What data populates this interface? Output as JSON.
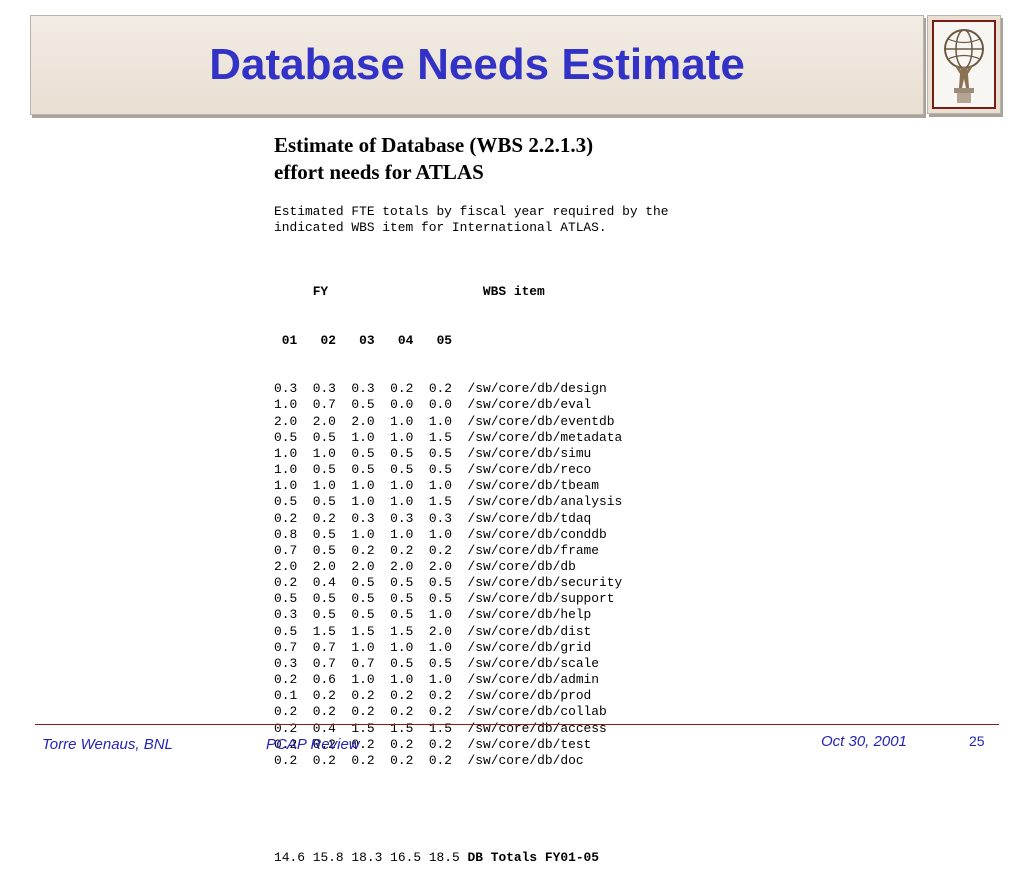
{
  "title": "Database Needs Estimate",
  "heading": [
    "Estimate of Database (WBS 2.2.1.3)",
    "effort needs for ATLAS"
  ],
  "description": [
    "Estimated FTE totals by fiscal year required by the",
    "indicated WBS item for International ATLAS."
  ],
  "table": {
    "group_header_fy": "FY",
    "group_header_item": "WBS item",
    "years": [
      "01",
      "02",
      "03",
      "04",
      "05"
    ],
    "rows": [
      {
        "values": [
          "0.3",
          "0.3",
          "0.3",
          "0.2",
          "0.2"
        ],
        "item": "/sw/core/db/design"
      },
      {
        "values": [
          "1.0",
          "0.7",
          "0.5",
          "0.0",
          "0.0"
        ],
        "item": "/sw/core/db/eval"
      },
      {
        "values": [
          "2.0",
          "2.0",
          "2.0",
          "1.0",
          "1.0"
        ],
        "item": "/sw/core/db/eventdb"
      },
      {
        "values": [
          "0.5",
          "0.5",
          "1.0",
          "1.0",
          "1.5"
        ],
        "item": "/sw/core/db/metadata"
      },
      {
        "values": [
          "1.0",
          "1.0",
          "0.5",
          "0.5",
          "0.5"
        ],
        "item": "/sw/core/db/simu"
      },
      {
        "values": [
          "1.0",
          "0.5",
          "0.5",
          "0.5",
          "0.5"
        ],
        "item": "/sw/core/db/reco"
      },
      {
        "values": [
          "1.0",
          "1.0",
          "1.0",
          "1.0",
          "1.0"
        ],
        "item": "/sw/core/db/tbeam"
      },
      {
        "values": [
          "0.5",
          "0.5",
          "1.0",
          "1.0",
          "1.5"
        ],
        "item": "/sw/core/db/analysis"
      },
      {
        "values": [
          "0.2",
          "0.2",
          "0.3",
          "0.3",
          "0.3"
        ],
        "item": "/sw/core/db/tdaq"
      },
      {
        "values": [
          "0.8",
          "0.5",
          "1.0",
          "1.0",
          "1.0"
        ],
        "item": "/sw/core/db/conddb"
      },
      {
        "values": [
          "0.7",
          "0.5",
          "0.2",
          "0.2",
          "0.2"
        ],
        "item": "/sw/core/db/frame"
      },
      {
        "values": [
          "2.0",
          "2.0",
          "2.0",
          "2.0",
          "2.0"
        ],
        "item": "/sw/core/db/db"
      },
      {
        "values": [
          "0.2",
          "0.4",
          "0.5",
          "0.5",
          "0.5"
        ],
        "item": "/sw/core/db/security"
      },
      {
        "values": [
          "0.5",
          "0.5",
          "0.5",
          "0.5",
          "0.5"
        ],
        "item": "/sw/core/db/support"
      },
      {
        "values": [
          "0.3",
          "0.5",
          "0.5",
          "0.5",
          "1.0"
        ],
        "item": "/sw/core/db/help"
      },
      {
        "values": [
          "0.5",
          "1.5",
          "1.5",
          "1.5",
          "2.0"
        ],
        "item": "/sw/core/db/dist"
      },
      {
        "values": [
          "0.7",
          "0.7",
          "1.0",
          "1.0",
          "1.0"
        ],
        "item": "/sw/core/db/grid"
      },
      {
        "values": [
          "0.3",
          "0.7",
          "0.7",
          "0.5",
          "0.5"
        ],
        "item": "/sw/core/db/scale"
      },
      {
        "values": [
          "0.2",
          "0.6",
          "1.0",
          "1.0",
          "1.0"
        ],
        "item": "/sw/core/db/admin"
      },
      {
        "values": [
          "0.1",
          "0.2",
          "0.2",
          "0.2",
          "0.2"
        ],
        "item": "/sw/core/db/prod"
      },
      {
        "values": [
          "0.2",
          "0.2",
          "0.2",
          "0.2",
          "0.2"
        ],
        "item": "/sw/core/db/collab"
      },
      {
        "values": [
          "0.2",
          "0.4",
          "1.5",
          "1.5",
          "1.5"
        ],
        "item": "/sw/core/db/access"
      },
      {
        "values": [
          "0.2",
          "0.2",
          "0.2",
          "0.2",
          "0.2"
        ],
        "item": "/sw/core/db/test"
      },
      {
        "values": [
          "0.2",
          "0.2",
          "0.2",
          "0.2",
          "0.2"
        ],
        "item": "/sw/core/db/doc"
      }
    ],
    "totals": {
      "values": [
        "14.6",
        "15.8",
        "18.3",
        "16.5",
        "18.5"
      ],
      "label": "DB Totals FY01-05"
    }
  },
  "footer": {
    "author": "Torre Wenaus, BNL",
    "event": "PCAP Review",
    "date": "Oct 30, 2001",
    "page": "25"
  },
  "logo": {
    "icon": "atlas-statue-icon"
  },
  "colors": {
    "title": "#3232c6",
    "footer_text": "#2424b8",
    "footer_rule": "#8b1a1a",
    "band": "#e9dfd2"
  }
}
